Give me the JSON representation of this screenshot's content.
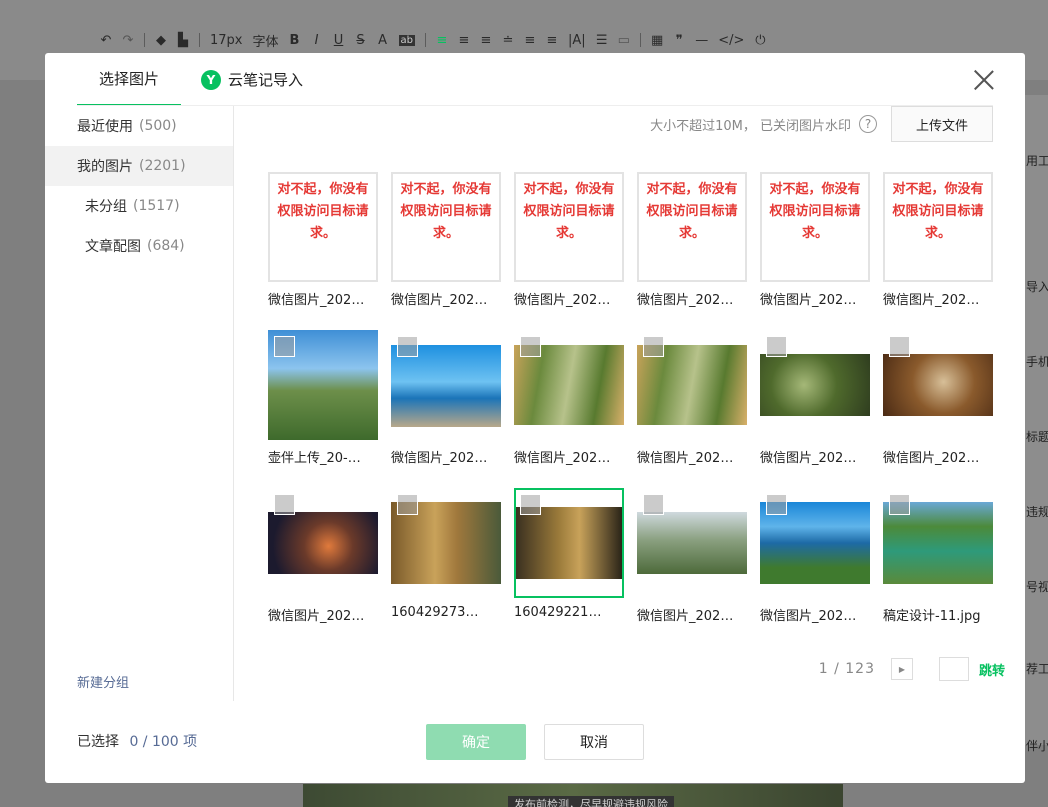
{
  "toolbar": {
    "font_size": "17px",
    "font_family": "字体"
  },
  "right_panel": [
    "用工",
    "导入",
    "手机",
    "标题",
    "违规",
    "号视",
    "荐工",
    "伴小"
  ],
  "background_caption": "发布前检测，尽早规避违规风险",
  "modal": {
    "tabs": [
      {
        "label": "选择图片",
        "active": true
      },
      {
        "label": "云笔记导入",
        "icon": "Y"
      }
    ],
    "sidebar": {
      "items": [
        {
          "label": "最近使用",
          "count": "(500)"
        },
        {
          "label": "我的图片",
          "count": "(2201)"
        },
        {
          "label": "未分组",
          "count": "(1517)"
        },
        {
          "label": "文章配图",
          "count": "(684)"
        }
      ],
      "new_group": "新建分组"
    },
    "hint": "大小不超过10M， 已关闭图片水印",
    "help_icon": "?",
    "upload_label": "上传文件",
    "error_text": "对不起，你没有权限访问目标请求。",
    "images": [
      {
        "name": "微信图片_202…",
        "error": true
      },
      {
        "name": "微信图片_202…",
        "error": true
      },
      {
        "name": "微信图片_202…",
        "error": true
      },
      {
        "name": "微信图片_202…",
        "error": true
      },
      {
        "name": "微信图片_202…",
        "error": true
      },
      {
        "name": "微信图片_202…",
        "error": true
      },
      {
        "name": "壶伴上传_20-…"
      },
      {
        "name": "微信图片_202…"
      },
      {
        "name": "微信图片_202…"
      },
      {
        "name": "微信图片_202…"
      },
      {
        "name": "微信图片_202…"
      },
      {
        "name": "微信图片_202…"
      },
      {
        "name": "微信图片_202…"
      },
      {
        "name": "160429273…"
      },
      {
        "name": "160429221…",
        "selected": true
      },
      {
        "name": "微信图片_202…"
      },
      {
        "name": "微信图片_202…"
      },
      {
        "name": "稿定设计-11.jpg"
      }
    ],
    "pagination": {
      "text": "1 / 123",
      "next_icon": "▶",
      "jump_label": "跳转"
    },
    "footer": {
      "selected_label": "已选择",
      "selected_count": "0 / 100 项",
      "confirm_label": "确定",
      "cancel_label": "取消"
    }
  },
  "colors": {
    "accent": "#07c160",
    "link": "#576b95",
    "error": "#e53935",
    "confirm_disabled": "#8fdcb1"
  }
}
